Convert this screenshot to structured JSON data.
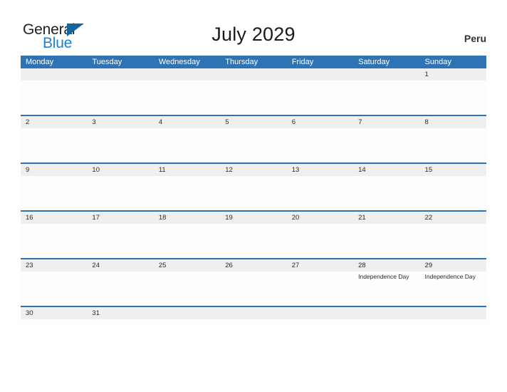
{
  "brand": {
    "name_part1": "General",
    "name_part2": "Blue",
    "triangle_icon": "triangle-right-icon",
    "color_dark": "#231f20",
    "color_blue": "#1b7fd4",
    "color_triangle": "#15659f"
  },
  "header": {
    "title": "July 2029",
    "country": "Peru"
  },
  "theme": {
    "header_blue": "#2e73b3",
    "row_band_gray": "#efefef",
    "cell_white": "#fdfdfd",
    "text_dark": "#2b2b2b"
  },
  "calendar": {
    "month": "July",
    "year": "2029",
    "weekday_headers": [
      "Monday",
      "Tuesday",
      "Wednesday",
      "Thursday",
      "Friday",
      "Saturday",
      "Sunday"
    ],
    "weeks": [
      [
        {
          "date": "",
          "event": ""
        },
        {
          "date": "",
          "event": ""
        },
        {
          "date": "",
          "event": ""
        },
        {
          "date": "",
          "event": ""
        },
        {
          "date": "",
          "event": ""
        },
        {
          "date": "",
          "event": ""
        },
        {
          "date": "1",
          "event": ""
        }
      ],
      [
        {
          "date": "2",
          "event": ""
        },
        {
          "date": "3",
          "event": ""
        },
        {
          "date": "4",
          "event": ""
        },
        {
          "date": "5",
          "event": ""
        },
        {
          "date": "6",
          "event": ""
        },
        {
          "date": "7",
          "event": ""
        },
        {
          "date": "8",
          "event": ""
        }
      ],
      [
        {
          "date": "9",
          "event": ""
        },
        {
          "date": "10",
          "event": ""
        },
        {
          "date": "11",
          "event": ""
        },
        {
          "date": "12",
          "event": ""
        },
        {
          "date": "13",
          "event": ""
        },
        {
          "date": "14",
          "event": ""
        },
        {
          "date": "15",
          "event": ""
        }
      ],
      [
        {
          "date": "16",
          "event": ""
        },
        {
          "date": "17",
          "event": ""
        },
        {
          "date": "18",
          "event": ""
        },
        {
          "date": "19",
          "event": ""
        },
        {
          "date": "20",
          "event": ""
        },
        {
          "date": "21",
          "event": ""
        },
        {
          "date": "22",
          "event": ""
        }
      ],
      [
        {
          "date": "23",
          "event": ""
        },
        {
          "date": "24",
          "event": ""
        },
        {
          "date": "25",
          "event": ""
        },
        {
          "date": "26",
          "event": ""
        },
        {
          "date": "27",
          "event": ""
        },
        {
          "date": "28",
          "event": "Independence Day"
        },
        {
          "date": "29",
          "event": "Independence Day"
        }
      ],
      [
        {
          "date": "30",
          "event": ""
        },
        {
          "date": "31",
          "event": ""
        },
        {
          "date": "",
          "event": ""
        },
        {
          "date": "",
          "event": ""
        },
        {
          "date": "",
          "event": ""
        },
        {
          "date": "",
          "event": ""
        },
        {
          "date": "",
          "event": ""
        }
      ]
    ]
  }
}
